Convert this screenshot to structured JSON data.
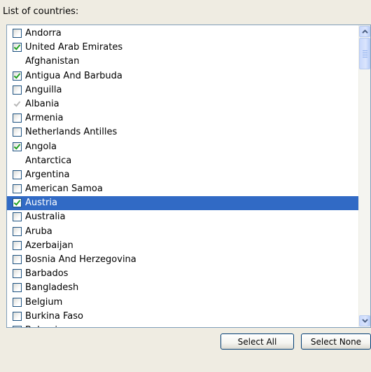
{
  "caption": "List of countries:",
  "countries": [
    {
      "name": "Andorra",
      "checked": false,
      "enabled": true
    },
    {
      "name": "United Arab Emirates",
      "checked": true,
      "enabled": true
    },
    {
      "name": "Afghanistan",
      "checked": false,
      "enabled": false
    },
    {
      "name": "Antigua And Barbuda",
      "checked": true,
      "enabled": true
    },
    {
      "name": "Anguilla",
      "checked": false,
      "enabled": true
    },
    {
      "name": "Albania",
      "checked": true,
      "enabled": false
    },
    {
      "name": "Armenia",
      "checked": false,
      "enabled": true
    },
    {
      "name": "Netherlands Antilles",
      "checked": false,
      "enabled": true
    },
    {
      "name": "Angola",
      "checked": true,
      "enabled": true
    },
    {
      "name": "Antarctica",
      "checked": false,
      "enabled": false
    },
    {
      "name": "Argentina",
      "checked": false,
      "enabled": true
    },
    {
      "name": "American Samoa",
      "checked": false,
      "enabled": true
    },
    {
      "name": "Austria",
      "checked": true,
      "enabled": true,
      "selected": true
    },
    {
      "name": "Australia",
      "checked": false,
      "enabled": true
    },
    {
      "name": "Aruba",
      "checked": false,
      "enabled": true
    },
    {
      "name": "Azerbaijan",
      "checked": false,
      "enabled": true
    },
    {
      "name": "Bosnia And Herzegovina",
      "checked": false,
      "enabled": true
    },
    {
      "name": "Barbados",
      "checked": false,
      "enabled": true
    },
    {
      "name": "Bangladesh",
      "checked": false,
      "enabled": true
    },
    {
      "name": "Belgium",
      "checked": false,
      "enabled": true
    },
    {
      "name": "Burkina Faso",
      "checked": false,
      "enabled": true
    },
    {
      "name": "Bulgaria",
      "checked": false,
      "enabled": true
    }
  ],
  "buttons": {
    "select_all": "Select All",
    "select_none": "Select None"
  },
  "colors": {
    "selection": "#316ac5",
    "checkmark": "#21a121",
    "dialog_background": "#efece2"
  }
}
